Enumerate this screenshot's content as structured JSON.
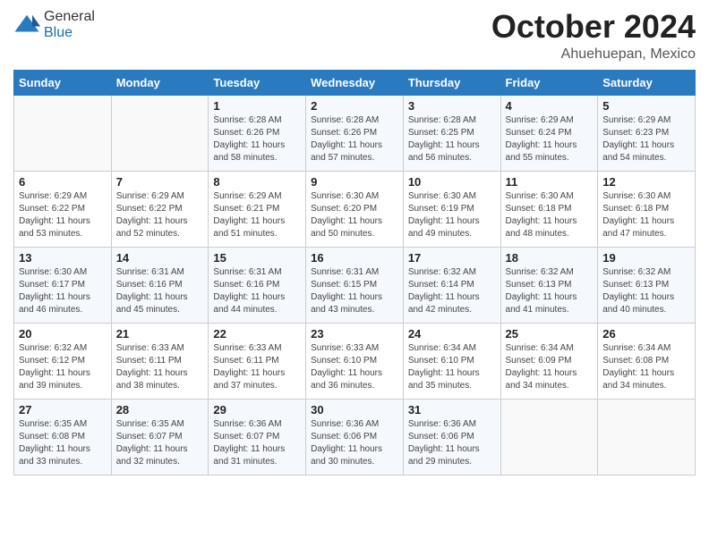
{
  "header": {
    "logo_general": "General",
    "logo_blue": "Blue",
    "month": "October 2024",
    "location": "Ahuehuepan, Mexico"
  },
  "days_of_week": [
    "Sunday",
    "Monday",
    "Tuesday",
    "Wednesday",
    "Thursday",
    "Friday",
    "Saturday"
  ],
  "weeks": [
    [
      {
        "day": "",
        "info": ""
      },
      {
        "day": "",
        "info": ""
      },
      {
        "day": "1",
        "info": "Sunrise: 6:28 AM\nSunset: 6:26 PM\nDaylight: 11 hours and 58 minutes."
      },
      {
        "day": "2",
        "info": "Sunrise: 6:28 AM\nSunset: 6:26 PM\nDaylight: 11 hours and 57 minutes."
      },
      {
        "day": "3",
        "info": "Sunrise: 6:28 AM\nSunset: 6:25 PM\nDaylight: 11 hours and 56 minutes."
      },
      {
        "day": "4",
        "info": "Sunrise: 6:29 AM\nSunset: 6:24 PM\nDaylight: 11 hours and 55 minutes."
      },
      {
        "day": "5",
        "info": "Sunrise: 6:29 AM\nSunset: 6:23 PM\nDaylight: 11 hours and 54 minutes."
      }
    ],
    [
      {
        "day": "6",
        "info": "Sunrise: 6:29 AM\nSunset: 6:22 PM\nDaylight: 11 hours and 53 minutes."
      },
      {
        "day": "7",
        "info": "Sunrise: 6:29 AM\nSunset: 6:22 PM\nDaylight: 11 hours and 52 minutes."
      },
      {
        "day": "8",
        "info": "Sunrise: 6:29 AM\nSunset: 6:21 PM\nDaylight: 11 hours and 51 minutes."
      },
      {
        "day": "9",
        "info": "Sunrise: 6:30 AM\nSunset: 6:20 PM\nDaylight: 11 hours and 50 minutes."
      },
      {
        "day": "10",
        "info": "Sunrise: 6:30 AM\nSunset: 6:19 PM\nDaylight: 11 hours and 49 minutes."
      },
      {
        "day": "11",
        "info": "Sunrise: 6:30 AM\nSunset: 6:18 PM\nDaylight: 11 hours and 48 minutes."
      },
      {
        "day": "12",
        "info": "Sunrise: 6:30 AM\nSunset: 6:18 PM\nDaylight: 11 hours and 47 minutes."
      }
    ],
    [
      {
        "day": "13",
        "info": "Sunrise: 6:30 AM\nSunset: 6:17 PM\nDaylight: 11 hours and 46 minutes."
      },
      {
        "day": "14",
        "info": "Sunrise: 6:31 AM\nSunset: 6:16 PM\nDaylight: 11 hours and 45 minutes."
      },
      {
        "day": "15",
        "info": "Sunrise: 6:31 AM\nSunset: 6:16 PM\nDaylight: 11 hours and 44 minutes."
      },
      {
        "day": "16",
        "info": "Sunrise: 6:31 AM\nSunset: 6:15 PM\nDaylight: 11 hours and 43 minutes."
      },
      {
        "day": "17",
        "info": "Sunrise: 6:32 AM\nSunset: 6:14 PM\nDaylight: 11 hours and 42 minutes."
      },
      {
        "day": "18",
        "info": "Sunrise: 6:32 AM\nSunset: 6:13 PM\nDaylight: 11 hours and 41 minutes."
      },
      {
        "day": "19",
        "info": "Sunrise: 6:32 AM\nSunset: 6:13 PM\nDaylight: 11 hours and 40 minutes."
      }
    ],
    [
      {
        "day": "20",
        "info": "Sunrise: 6:32 AM\nSunset: 6:12 PM\nDaylight: 11 hours and 39 minutes."
      },
      {
        "day": "21",
        "info": "Sunrise: 6:33 AM\nSunset: 6:11 PM\nDaylight: 11 hours and 38 minutes."
      },
      {
        "day": "22",
        "info": "Sunrise: 6:33 AM\nSunset: 6:11 PM\nDaylight: 11 hours and 37 minutes."
      },
      {
        "day": "23",
        "info": "Sunrise: 6:33 AM\nSunset: 6:10 PM\nDaylight: 11 hours and 36 minutes."
      },
      {
        "day": "24",
        "info": "Sunrise: 6:34 AM\nSunset: 6:10 PM\nDaylight: 11 hours and 35 minutes."
      },
      {
        "day": "25",
        "info": "Sunrise: 6:34 AM\nSunset: 6:09 PM\nDaylight: 11 hours and 34 minutes."
      },
      {
        "day": "26",
        "info": "Sunrise: 6:34 AM\nSunset: 6:08 PM\nDaylight: 11 hours and 34 minutes."
      }
    ],
    [
      {
        "day": "27",
        "info": "Sunrise: 6:35 AM\nSunset: 6:08 PM\nDaylight: 11 hours and 33 minutes."
      },
      {
        "day": "28",
        "info": "Sunrise: 6:35 AM\nSunset: 6:07 PM\nDaylight: 11 hours and 32 minutes."
      },
      {
        "day": "29",
        "info": "Sunrise: 6:36 AM\nSunset: 6:07 PM\nDaylight: 11 hours and 31 minutes."
      },
      {
        "day": "30",
        "info": "Sunrise: 6:36 AM\nSunset: 6:06 PM\nDaylight: 11 hours and 30 minutes."
      },
      {
        "day": "31",
        "info": "Sunrise: 6:36 AM\nSunset: 6:06 PM\nDaylight: 11 hours and 29 minutes."
      },
      {
        "day": "",
        "info": ""
      },
      {
        "day": "",
        "info": ""
      }
    ]
  ]
}
